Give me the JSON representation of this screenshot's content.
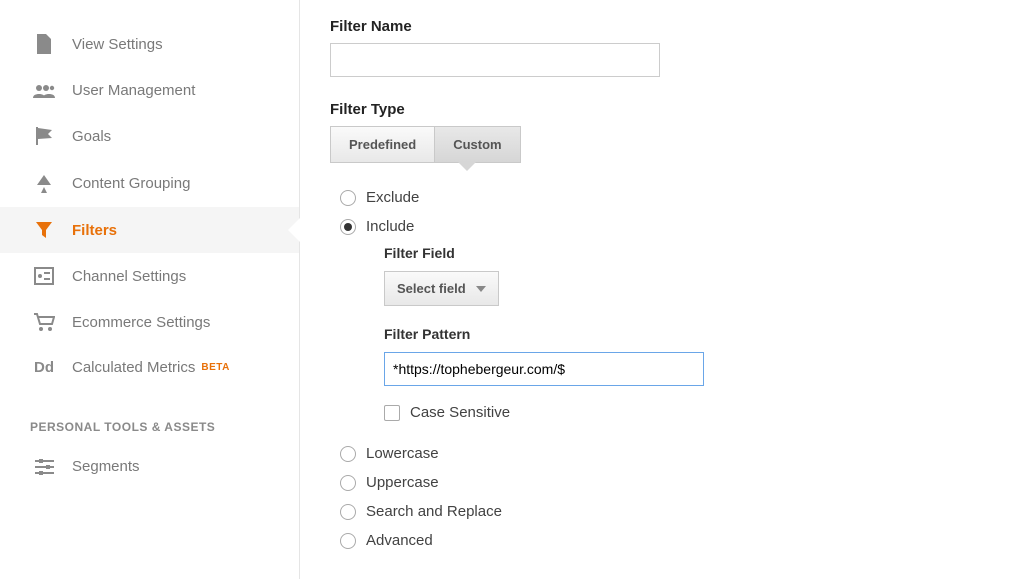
{
  "sidebar": {
    "items": [
      {
        "label": "View Settings"
      },
      {
        "label": "User Management"
      },
      {
        "label": "Goals"
      },
      {
        "label": "Content Grouping"
      },
      {
        "label": "Filters"
      },
      {
        "label": "Channel Settings"
      },
      {
        "label": "Ecommerce Settings"
      },
      {
        "label": "Calculated Metrics",
        "badge": "BETA",
        "prefix": "Dd"
      }
    ],
    "section_header": "PERSONAL TOOLS & ASSETS",
    "tools": [
      {
        "label": "Segments"
      }
    ]
  },
  "main": {
    "filter_name_label": "Filter Name",
    "filter_name_value": "",
    "filter_type_label": "Filter Type",
    "type_tabs": {
      "predefined": "Predefined",
      "custom": "Custom"
    },
    "radios": {
      "exclude": "Exclude",
      "include": "Include",
      "lowercase": "Lowercase",
      "uppercase": "Uppercase",
      "search_replace": "Search and Replace",
      "advanced": "Advanced"
    },
    "filter_field_label": "Filter Field",
    "select_field": "Select field",
    "filter_pattern_label": "Filter Pattern",
    "filter_pattern_value": "*https://tophebergeur.com/$",
    "case_sensitive": "Case Sensitive"
  }
}
